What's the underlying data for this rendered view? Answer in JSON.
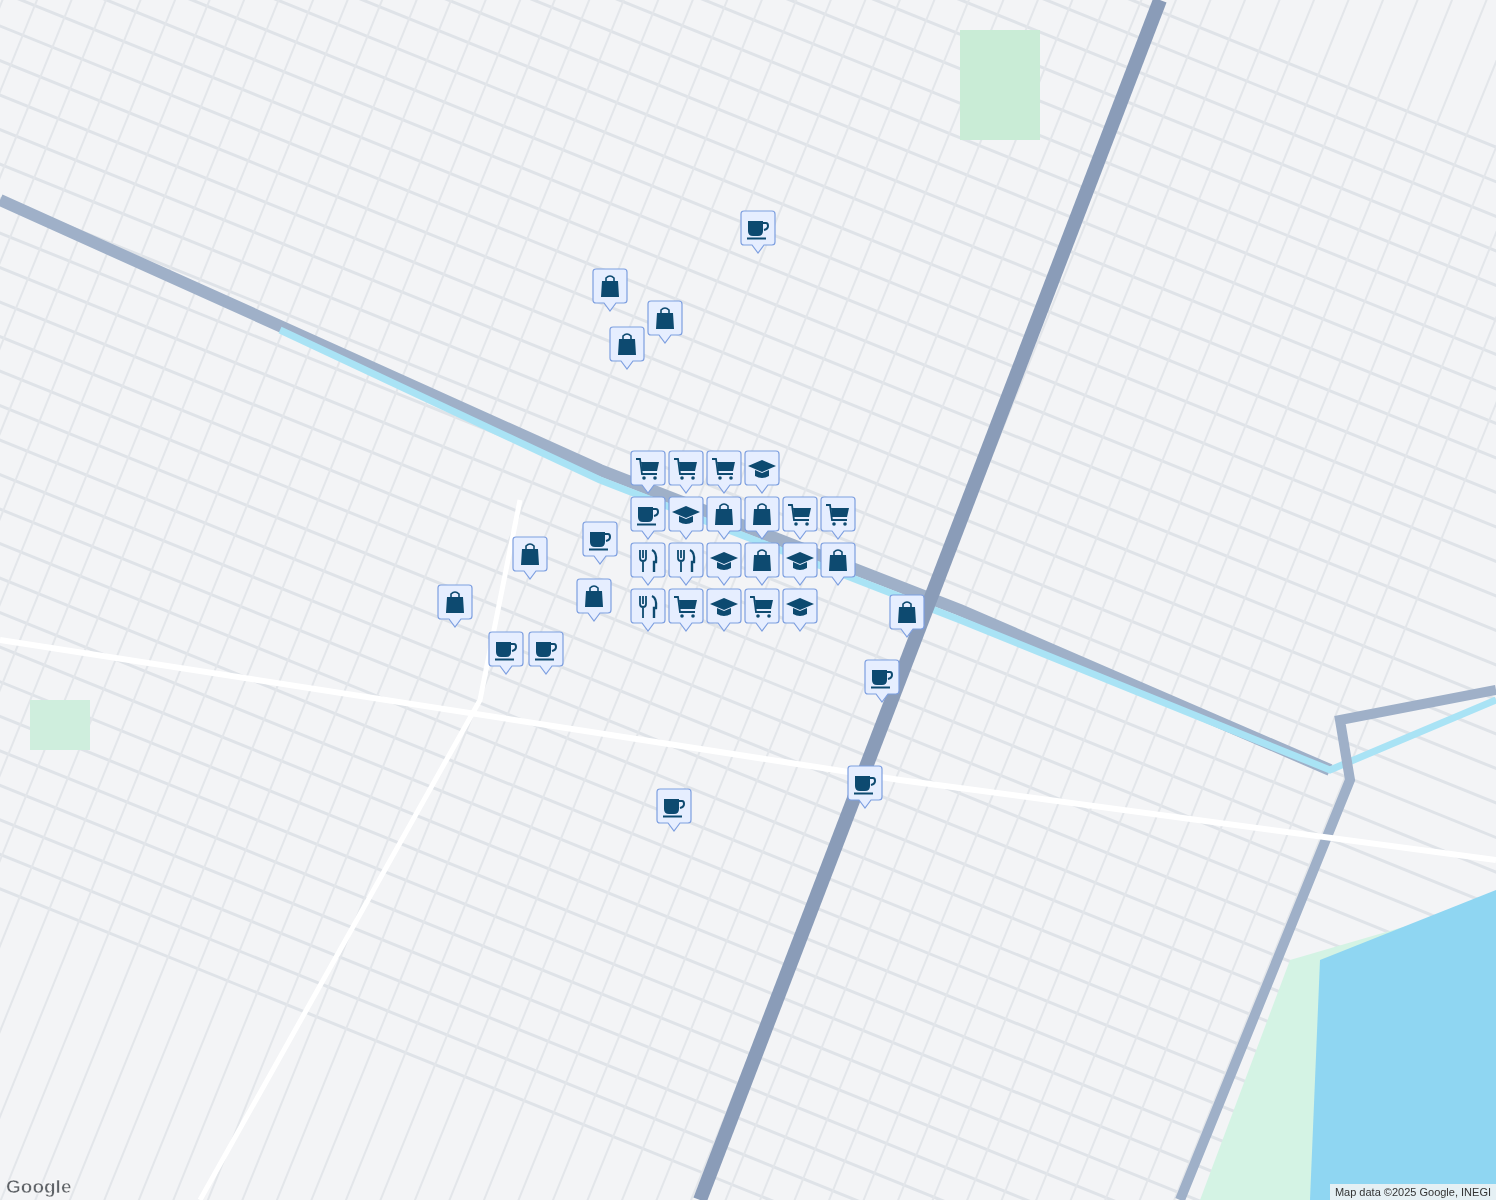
{
  "map": {
    "markers": [
      {
        "kind": "cup"
      },
      {
        "kind": "bag"
      },
      {
        "kind": "bag"
      },
      {
        "kind": "bag"
      },
      {
        "kind": "cap"
      },
      {
        "kind": "cart"
      },
      {
        "kind": "cart"
      },
      {
        "kind": "cart"
      },
      {
        "kind": "cup"
      },
      {
        "kind": "cup"
      },
      {
        "kind": "cap"
      },
      {
        "kind": "bag"
      },
      {
        "kind": "bag"
      },
      {
        "kind": "cart"
      },
      {
        "kind": "cart"
      },
      {
        "kind": "fork"
      },
      {
        "kind": "fork"
      },
      {
        "kind": "cap"
      },
      {
        "kind": "bag"
      },
      {
        "kind": "cap"
      },
      {
        "kind": "bag"
      },
      {
        "kind": "fork"
      },
      {
        "kind": "cart"
      },
      {
        "kind": "cap"
      },
      {
        "kind": "cart"
      },
      {
        "kind": "cap"
      },
      {
        "kind": "bag"
      },
      {
        "kind": "bag"
      },
      {
        "kind": "cup"
      },
      {
        "kind": "cup"
      },
      {
        "kind": "bag"
      },
      {
        "kind": "bag"
      },
      {
        "kind": "cup"
      },
      {
        "kind": "cup"
      },
      {
        "kind": "cup"
      }
    ]
  },
  "logo": "Google",
  "attribution": "Map data ©2025 Google, INEGI"
}
